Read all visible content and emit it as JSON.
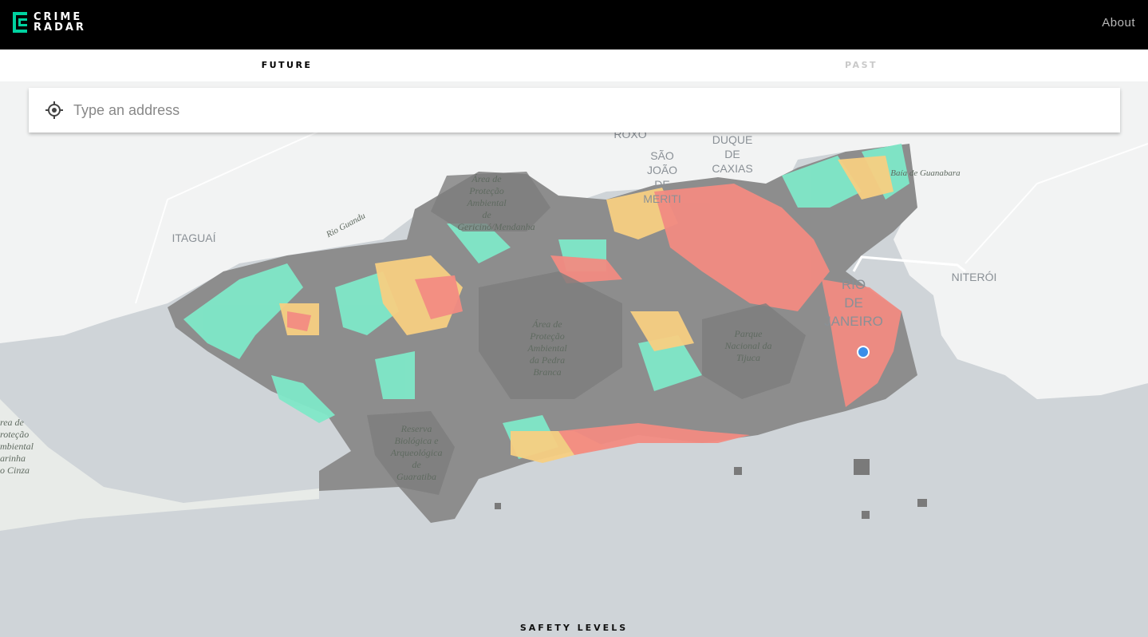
{
  "app": {
    "logo_text_line1": "CRIME",
    "logo_text_line2": "RADAR",
    "about_link": "About"
  },
  "tabs": [
    {
      "label": "FUTURE",
      "active": true
    },
    {
      "label": "PAST",
      "active": false
    }
  ],
  "search": {
    "placeholder": "Type an address",
    "value": ""
  },
  "map": {
    "labels": {
      "roxo": "ROXO",
      "sao_joao_l1": "SÃO",
      "sao_joao_l2": "JOÃO",
      "sao_joao_l3": "DE",
      "sao_joao_l4": "MERITI",
      "duque_l1": "DUQUE",
      "duque_l2": "DE",
      "duque_l3": "CAXIAS",
      "baia": "Baía de Guanabara",
      "rio_guandu": "Rio Guandu",
      "itaguai": "ITAGUAÍ",
      "apa_gericino_l1": "Área de",
      "apa_gericino_l2": "Proteção",
      "apa_gericino_l3": "Ambiental",
      "apa_gericino_l4": "de",
      "apa_gericino_l5": "Gericinó/Mendanha",
      "niteroi": "NITERÓI",
      "rio_l1": "RIO",
      "rio_l2": "DE",
      "rio_l3": "JANEIRO",
      "apa_pedra_l1": "Área de",
      "apa_pedra_l2": "Proteção",
      "apa_pedra_l3": "Ambiental",
      "apa_pedra_l4": "da Pedra",
      "apa_pedra_l5": "Branca",
      "tijuca_l1": "Parque",
      "tijuca_l2": "Nacional da",
      "tijuca_l3": "Tijuca",
      "guaratiba_l1": "Reserva",
      "guaratiba_l2": "Biológica e",
      "guaratiba_l3": "Arqueológica",
      "guaratiba_l4": "de",
      "guaratiba_l5": "Guaratiba",
      "left_l1": "rea de",
      "left_l2": "roteção",
      "left_l3": "mbiental",
      "left_l4": "arinha",
      "left_l5": "o Cinza"
    },
    "colors": {
      "water": "#cfd4d8",
      "land": "#f2f3f3",
      "city_gray": "#8a8a8a",
      "safe": "#7fe8c8",
      "medium": "#f7d27a",
      "danger": "#f28b82",
      "location_dot": "#3b8ee8"
    }
  },
  "legend": {
    "title": "SAFETY LEVELS"
  },
  "icons": {
    "locate": "crosshair-locate-icon",
    "location_marker": "current-location-icon"
  }
}
